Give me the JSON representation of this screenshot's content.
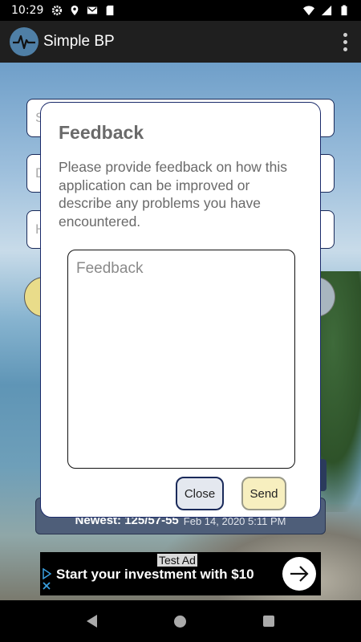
{
  "status_bar": {
    "time": "10:29",
    "left_icons": [
      "gear-icon",
      "location-icon",
      "gmail-icon",
      "sd-card-icon"
    ],
    "right_icons": [
      "wifi-icon",
      "signal-icon",
      "battery-icon"
    ]
  },
  "app_bar": {
    "title": "Simple BP",
    "logo_icon": "heartbeat-icon",
    "menu_icon": "overflow-menu-icon"
  },
  "background_form": {
    "field_1_placeholder": "S",
    "field_2_placeholder": "D",
    "field_3_placeholder": "H",
    "newest_label": "Newest: 125/57-55",
    "newest_date": "Feb 14, 2020 5:11 PM"
  },
  "dialog": {
    "title": "Feedback",
    "message": "Please provide feedback on how this application can be improved or describe any problems you have encountered.",
    "input_placeholder": "Feedback",
    "input_value": "",
    "close_label": "Close",
    "send_label": "Send"
  },
  "ad": {
    "label": "Test Ad",
    "text": "Start your investment with $10",
    "arrow_icon": "arrow-right-icon",
    "choices_icon": "ad-choices-icon"
  },
  "nav_bar": {
    "icons": [
      "back-icon",
      "home-icon",
      "recents-icon"
    ]
  },
  "colors": {
    "app_bar": "#1f1f1f",
    "dialog_border": "#1a2a6a",
    "close_button": "#e4e8ef",
    "send_button": "#f7efbf"
  }
}
